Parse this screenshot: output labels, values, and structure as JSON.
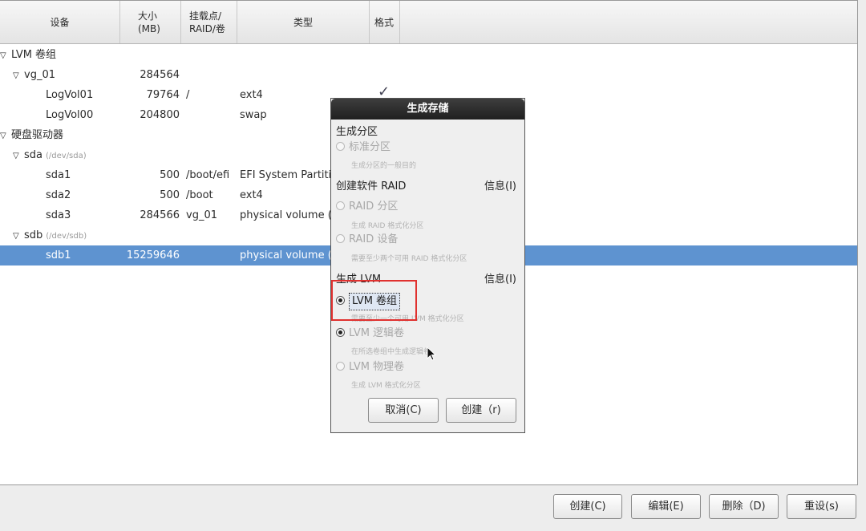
{
  "headers": {
    "device": "设备",
    "size": "大小\n(MB)",
    "mount": "挂载点/\nRAID/卷",
    "type": "类型",
    "format": "格式"
  },
  "rows": [
    {
      "name": "LVM 卷组",
      "path": "",
      "size": "",
      "mount": "",
      "type": "",
      "expander": "▽",
      "selected": false
    },
    {
      "name": "vg_01",
      "path": "",
      "size": "284564",
      "mount": "",
      "type": "",
      "expander": "▽",
      "selected": false
    },
    {
      "name": "LogVol01",
      "path": "",
      "size": "79764",
      "mount": "/",
      "type": "ext4",
      "expander": "",
      "selected": false
    },
    {
      "name": "LogVol00",
      "path": "",
      "size": "204800",
      "mount": "",
      "type": "swap",
      "expander": "",
      "selected": false
    },
    {
      "name": "硬盘驱动器",
      "path": "",
      "size": "",
      "mount": "",
      "type": "",
      "expander": "▽",
      "selected": false
    },
    {
      "name": "sda",
      "path": "(/dev/sda)",
      "size": "",
      "mount": "",
      "type": "",
      "expander": "▽",
      "selected": false
    },
    {
      "name": "sda1",
      "path": "",
      "size": "500",
      "mount": "/boot/efi",
      "type": "EFI System Partition",
      "expander": "",
      "selected": false
    },
    {
      "name": "sda2",
      "path": "",
      "size": "500",
      "mount": "/boot",
      "type": "ext4",
      "expander": "",
      "selected": false
    },
    {
      "name": "sda3",
      "path": "",
      "size": "284566",
      "mount": "vg_01",
      "type": "physical volume (LVM)",
      "expander": "",
      "selected": false
    },
    {
      "name": "sdb",
      "path": "(/dev/sdb)",
      "size": "",
      "mount": "",
      "type": "",
      "expander": "▽",
      "selected": false
    },
    {
      "name": "sdb1",
      "path": "",
      "size": "15259646",
      "mount": "",
      "type": "physical volume (LVM)",
      "expander": "",
      "selected": true
    }
  ],
  "format_check": "✓",
  "dialog": {
    "title": "生成存储",
    "section_partition": "生成分区",
    "standard_partition": "标准分区",
    "standard_partition_desc": "生成分区的一般目的",
    "section_raid": "创建软件 RAID",
    "raid_info": "信息(I)",
    "raid_partition": "RAID 分区",
    "raid_partition_desc": "生成 RAID 格式化分区",
    "raid_device": "RAID 设备",
    "raid_device_desc": "需要至少两个可用 RAID 格式化分区",
    "section_lvm": "生成 LVM",
    "lvm_info": "信息(I)",
    "lvm_group": "LVM 卷组",
    "lvm_group_desc": "需要至少一个可用 LVM 格式化分区",
    "lvm_logical": "LVM 逻辑卷",
    "lvm_logical_desc": "在所选卷组中生成逻辑卷",
    "lvm_physical": "LVM 物理卷",
    "lvm_physical_desc": "生成 LVM 格式化分区",
    "cancel": "取消(C)",
    "create": "创建（r)"
  },
  "buttons": {
    "create": "创建(C)",
    "edit": "编辑(E)",
    "delete": "删除（D)",
    "reset": "重设(s)"
  },
  "colors": {
    "selection": "#5e93d0",
    "highlight_box": "#e0312f"
  }
}
